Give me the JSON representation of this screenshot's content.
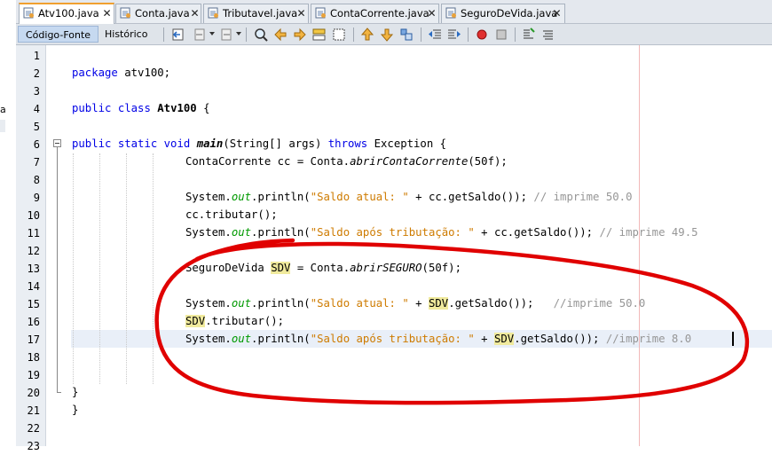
{
  "tabs": [
    {
      "label": "Atv100.java",
      "active": true
    },
    {
      "label": "Conta.java",
      "active": false
    },
    {
      "label": "Tributavel.java",
      "active": false
    },
    {
      "label": "ContaCorrente.java",
      "active": false
    },
    {
      "label": "SeguroDeVida.java",
      "active": false
    }
  ],
  "toolbar": {
    "source_tab": "Código-Fonte",
    "history_tab": "Histórico"
  },
  "left_panel": {
    "clipped_text": "a"
  },
  "line_numbers": [
    "1",
    "2",
    "3",
    "4",
    "5",
    "6",
    "7",
    "8",
    "9",
    "10",
    "11",
    "12",
    "13",
    "14",
    "15",
    "16",
    "17",
    "18",
    "19",
    "20",
    "21",
    "22",
    "23"
  ],
  "code": {
    "l2_kw": "package",
    "l2_rest": " atv100;",
    "l4_kw1": "public",
    "l4_kw2": "class",
    "l4_name": "Atv100",
    "l4_rest": " {",
    "l6_kw1": "public",
    "l6_kw2": "static",
    "l6_kw3": "void",
    "l6_method": "main",
    "l6_args": "(String[] args) ",
    "l6_kw4": "throws",
    "l6_rest": " Exception {",
    "l7_a": "ContaCorrente cc = Conta.",
    "l7_method": "abrirContaCorrente",
    "l7_b": "(50f);",
    "l9_a": "System.",
    "l9_out": "out",
    "l9_b": ".println(",
    "l9_str": "\"Saldo atual: \"",
    "l9_c": " + cc.getSaldo()); ",
    "l9_cmt": "// imprime 50.0",
    "l10": "cc.tributar();",
    "l11_a": "System.",
    "l11_out": "out",
    "l11_b": ".println(",
    "l11_str": "\"Saldo após tributação: \"",
    "l11_c": " + cc.getSaldo()); ",
    "l11_cmt": "// imprime 49.5",
    "l13_a": "SeguroDeVida ",
    "l13_var": "SDV",
    "l13_b": " = Conta.",
    "l13_method": "abrirSEGURO",
    "l13_c": "(50f);",
    "l15_a": "System.",
    "l15_out": "out",
    "l15_b": ".println(",
    "l15_str": "\"Saldo atual: \"",
    "l15_c": " + ",
    "l15_var": "SDV",
    "l15_d": ".getSaldo());   ",
    "l15_cmt": "//imprime 50.0",
    "l16_var": "SDV",
    "l16_rest": ".tributar();",
    "l17_a": "System.",
    "l17_out": "out",
    "l17_b": ".println(",
    "l17_str": "\"Saldo após tributação: \"",
    "l17_c": " + ",
    "l17_var": "SDV",
    "l17_d": ".getSaldo()); ",
    "l17_cmt": "//imprime 8.0",
    "l20": "}",
    "l21": "}"
  },
  "colors": {
    "keyword": "#0000e6",
    "string": "#ce7b00",
    "comment": "#969696",
    "field": "#009900",
    "highlight": "#f0ea9d",
    "annotation": "#e00000"
  }
}
